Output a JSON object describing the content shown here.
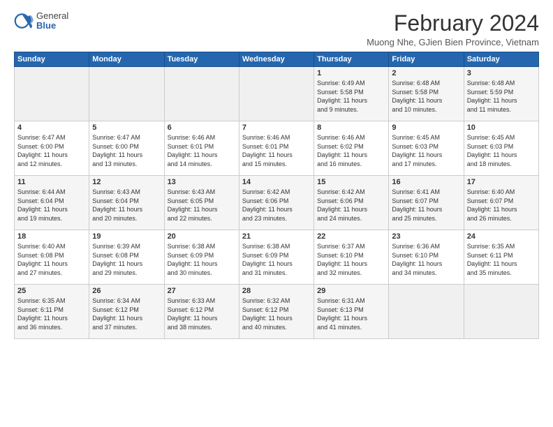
{
  "logo": {
    "general": "General",
    "blue": "Blue"
  },
  "title": "February 2024",
  "location": "Muong Nhe, GJien Bien Province, Vietnam",
  "days_header": [
    "Sunday",
    "Monday",
    "Tuesday",
    "Wednesday",
    "Thursday",
    "Friday",
    "Saturday"
  ],
  "weeks": [
    [
      {
        "day": "",
        "info": ""
      },
      {
        "day": "",
        "info": ""
      },
      {
        "day": "",
        "info": ""
      },
      {
        "day": "",
        "info": ""
      },
      {
        "day": "1",
        "info": "Sunrise: 6:49 AM\nSunset: 5:58 PM\nDaylight: 11 hours\nand 9 minutes."
      },
      {
        "day": "2",
        "info": "Sunrise: 6:48 AM\nSunset: 5:58 PM\nDaylight: 11 hours\nand 10 minutes."
      },
      {
        "day": "3",
        "info": "Sunrise: 6:48 AM\nSunset: 5:59 PM\nDaylight: 11 hours\nand 11 minutes."
      }
    ],
    [
      {
        "day": "4",
        "info": "Sunrise: 6:47 AM\nSunset: 6:00 PM\nDaylight: 11 hours\nand 12 minutes."
      },
      {
        "day": "5",
        "info": "Sunrise: 6:47 AM\nSunset: 6:00 PM\nDaylight: 11 hours\nand 13 minutes."
      },
      {
        "day": "6",
        "info": "Sunrise: 6:46 AM\nSunset: 6:01 PM\nDaylight: 11 hours\nand 14 minutes."
      },
      {
        "day": "7",
        "info": "Sunrise: 6:46 AM\nSunset: 6:01 PM\nDaylight: 11 hours\nand 15 minutes."
      },
      {
        "day": "8",
        "info": "Sunrise: 6:46 AM\nSunset: 6:02 PM\nDaylight: 11 hours\nand 16 minutes."
      },
      {
        "day": "9",
        "info": "Sunrise: 6:45 AM\nSunset: 6:03 PM\nDaylight: 11 hours\nand 17 minutes."
      },
      {
        "day": "10",
        "info": "Sunrise: 6:45 AM\nSunset: 6:03 PM\nDaylight: 11 hours\nand 18 minutes."
      }
    ],
    [
      {
        "day": "11",
        "info": "Sunrise: 6:44 AM\nSunset: 6:04 PM\nDaylight: 11 hours\nand 19 minutes."
      },
      {
        "day": "12",
        "info": "Sunrise: 6:43 AM\nSunset: 6:04 PM\nDaylight: 11 hours\nand 20 minutes."
      },
      {
        "day": "13",
        "info": "Sunrise: 6:43 AM\nSunset: 6:05 PM\nDaylight: 11 hours\nand 22 minutes."
      },
      {
        "day": "14",
        "info": "Sunrise: 6:42 AM\nSunset: 6:06 PM\nDaylight: 11 hours\nand 23 minutes."
      },
      {
        "day": "15",
        "info": "Sunrise: 6:42 AM\nSunset: 6:06 PM\nDaylight: 11 hours\nand 24 minutes."
      },
      {
        "day": "16",
        "info": "Sunrise: 6:41 AM\nSunset: 6:07 PM\nDaylight: 11 hours\nand 25 minutes."
      },
      {
        "day": "17",
        "info": "Sunrise: 6:40 AM\nSunset: 6:07 PM\nDaylight: 11 hours\nand 26 minutes."
      }
    ],
    [
      {
        "day": "18",
        "info": "Sunrise: 6:40 AM\nSunset: 6:08 PM\nDaylight: 11 hours\nand 27 minutes."
      },
      {
        "day": "19",
        "info": "Sunrise: 6:39 AM\nSunset: 6:08 PM\nDaylight: 11 hours\nand 29 minutes."
      },
      {
        "day": "20",
        "info": "Sunrise: 6:38 AM\nSunset: 6:09 PM\nDaylight: 11 hours\nand 30 minutes."
      },
      {
        "day": "21",
        "info": "Sunrise: 6:38 AM\nSunset: 6:09 PM\nDaylight: 11 hours\nand 31 minutes."
      },
      {
        "day": "22",
        "info": "Sunrise: 6:37 AM\nSunset: 6:10 PM\nDaylight: 11 hours\nand 32 minutes."
      },
      {
        "day": "23",
        "info": "Sunrise: 6:36 AM\nSunset: 6:10 PM\nDaylight: 11 hours\nand 34 minutes."
      },
      {
        "day": "24",
        "info": "Sunrise: 6:35 AM\nSunset: 6:11 PM\nDaylight: 11 hours\nand 35 minutes."
      }
    ],
    [
      {
        "day": "25",
        "info": "Sunrise: 6:35 AM\nSunset: 6:11 PM\nDaylight: 11 hours\nand 36 minutes."
      },
      {
        "day": "26",
        "info": "Sunrise: 6:34 AM\nSunset: 6:12 PM\nDaylight: 11 hours\nand 37 minutes."
      },
      {
        "day": "27",
        "info": "Sunrise: 6:33 AM\nSunset: 6:12 PM\nDaylight: 11 hours\nand 38 minutes."
      },
      {
        "day": "28",
        "info": "Sunrise: 6:32 AM\nSunset: 6:12 PM\nDaylight: 11 hours\nand 40 minutes."
      },
      {
        "day": "29",
        "info": "Sunrise: 6:31 AM\nSunset: 6:13 PM\nDaylight: 11 hours\nand 41 minutes."
      },
      {
        "day": "",
        "info": ""
      },
      {
        "day": "",
        "info": ""
      }
    ]
  ]
}
